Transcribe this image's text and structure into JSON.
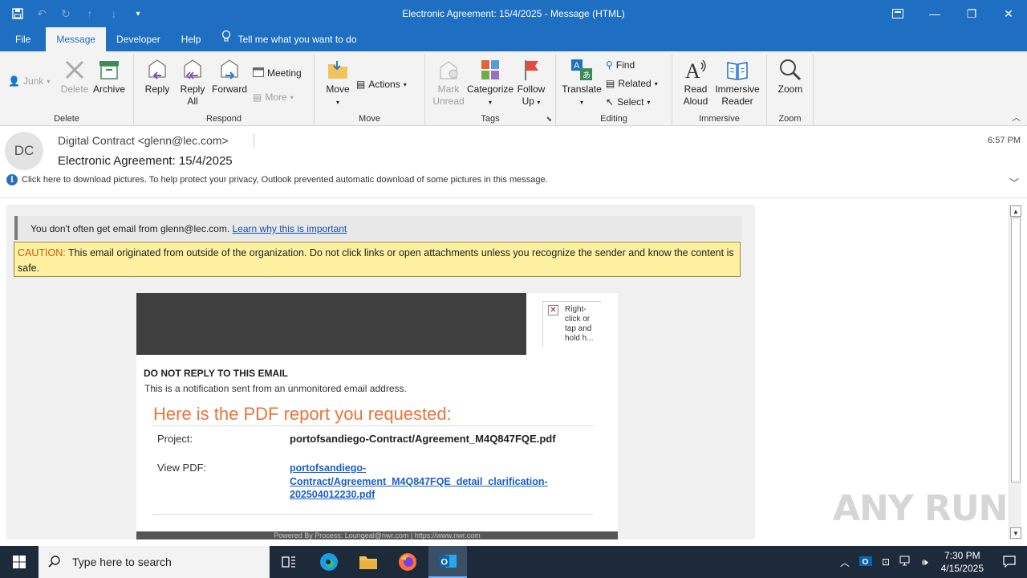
{
  "window": {
    "title": "Electronic Agreement: 15/4/2025  -  Message (HTML)"
  },
  "tabs": [
    {
      "label": "File"
    },
    {
      "label": "Message"
    },
    {
      "label": "Developer"
    },
    {
      "label": "Help"
    },
    {
      "label": "Tell me what you want to do"
    }
  ],
  "ribbon": {
    "delete_group": {
      "label": "Delete",
      "junk": "Junk",
      "delete": "Delete",
      "archive": "Archive"
    },
    "respond_group": {
      "label": "Respond",
      "reply": "Reply",
      "reply_all_1": "Reply",
      "reply_all_2": "All",
      "forward": "Forward",
      "meeting": "Meeting",
      "more": "More"
    },
    "move_group": {
      "label": "Move",
      "move": "Move",
      "actions": "Actions"
    },
    "tags_group": {
      "label": "Tags",
      "mark_unread_1": "Mark",
      "mark_unread_2": "Unread",
      "categorize": "Categorize",
      "follow_up_1": "Follow",
      "follow_up_2": "Up"
    },
    "editing_group": {
      "label": "Editing",
      "translate": "Translate",
      "find": "Find",
      "related": "Related",
      "select": "Select"
    },
    "immersive_group": {
      "label": "Immersive",
      "read_aloud_1": "Read",
      "read_aloud_2": "Aloud",
      "immersive_reader_1": "Immersive",
      "immersive_reader_2": "Reader"
    },
    "zoom_group": {
      "label": "Zoom",
      "zoom": "Zoom"
    }
  },
  "message": {
    "avatar_initials": "DC",
    "from": "Digital Contract <glenn@lec.com>",
    "subject": "Electronic Agreement: 15/4/2025",
    "time": "6:57 PM",
    "info_bar": "Click here to download pictures. To help protect your privacy, Outlook prevented automatic download of some pictures in this message."
  },
  "body": {
    "notice_text": "You don't often get email from glenn@lec.com.",
    "notice_link": "Learn why this is important",
    "caution_label": "CAUTION:",
    "caution_text": " This email originated from outside of the organization. Do not click links or open attachments unless you recognize the sender and know the content is safe.",
    "broken_image_text": "Right-click or tap and hold h...",
    "do_not_reply": "DO NOT REPLY TO THIS EMAIL",
    "notification": "This is a notification sent from an unmonitored email address.",
    "headline": "Here is the PDF report you requested:",
    "project_label": "Project:",
    "project_value": "portofsandiego-Contract/Agreement_M4Q847FQE.pdf",
    "view_pdf_label": "View PDF:",
    "view_pdf_link": "portofsandiego-Contract/Agreement_M4Q847FQE_detail_clarification-202504012230.pdf",
    "footer_text": "Powered By Process: Loungeal@nwr.com | https://www.nwr.com"
  },
  "watermark": "ANY RUN",
  "taskbar": {
    "search_placeholder": "Type here to search",
    "clock_time": "7:30 PM",
    "clock_date": "4/15/2025"
  },
  "colors": {
    "title_blue": "#1e6ec1",
    "caution_bg": "#fdf0a0",
    "headline_orange": "#e8743b",
    "link_blue": "#1a5fc8"
  }
}
